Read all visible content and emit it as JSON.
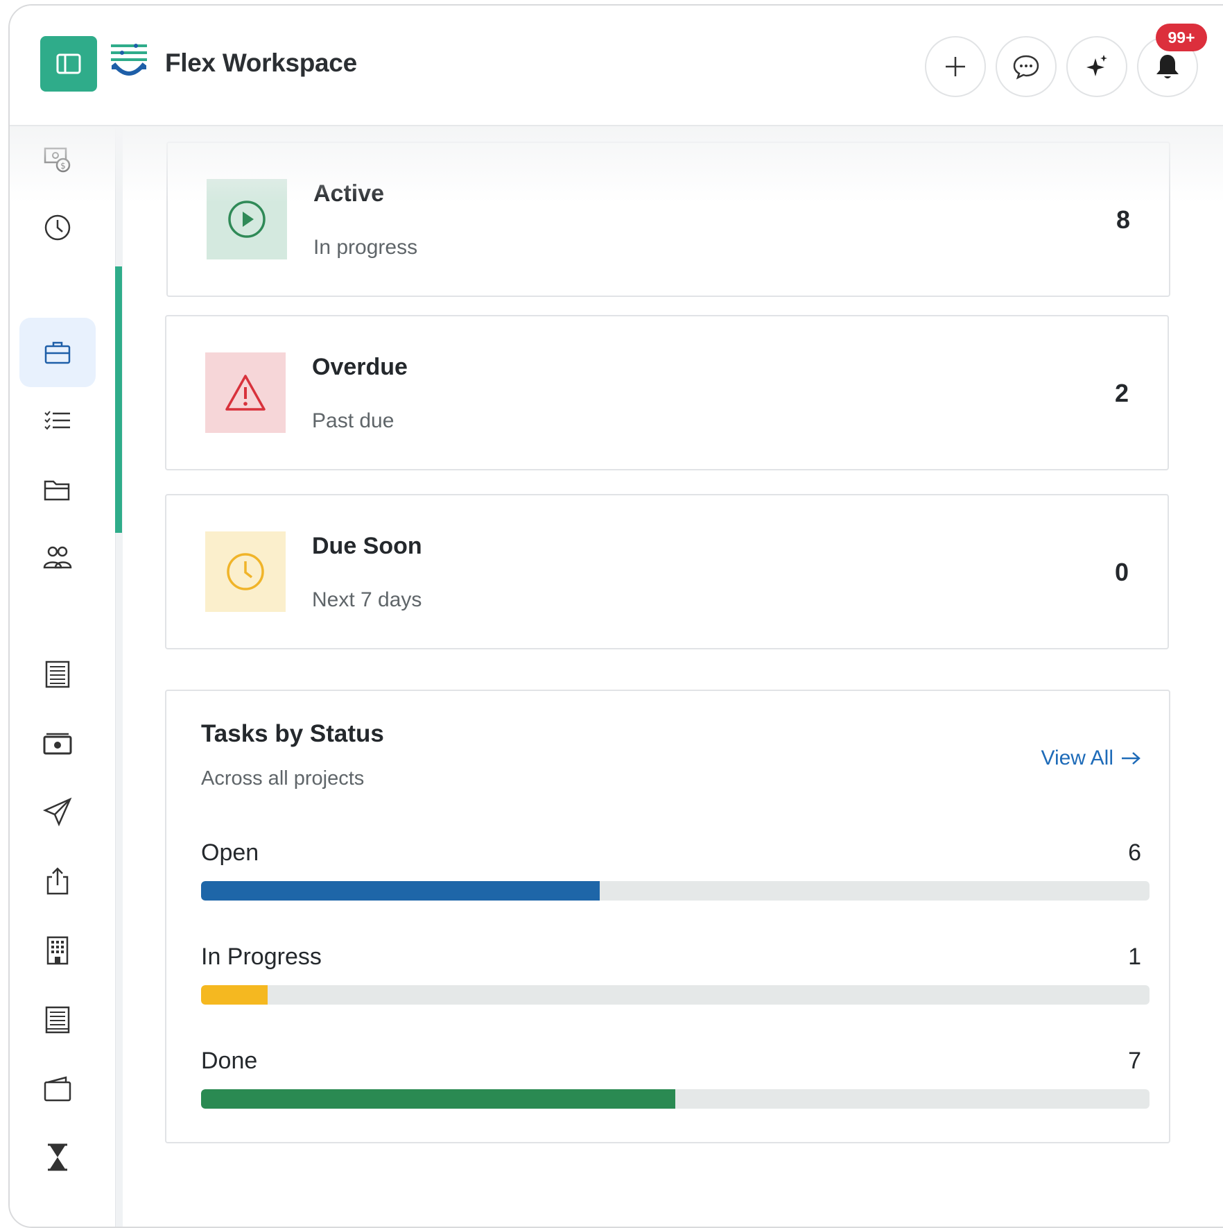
{
  "header": {
    "app_title": "Flex Workspace",
    "notification_badge": "99+",
    "actions": [
      "add-icon",
      "chat-icon",
      "sparkle-icon",
      "bell-icon"
    ]
  },
  "sidebar": {
    "items": [
      {
        "icon": "money-settings-icon",
        "active": false
      },
      {
        "icon": "clock-icon",
        "active": false
      },
      {
        "icon": "briefcase-icon",
        "active": true
      },
      {
        "icon": "checklist-icon",
        "active": false
      },
      {
        "icon": "folder-icon",
        "active": false
      },
      {
        "icon": "users-icon",
        "active": false
      },
      {
        "icon": "document-icon",
        "active": false
      },
      {
        "icon": "cash-icon",
        "active": false
      },
      {
        "icon": "send-icon",
        "active": false
      },
      {
        "icon": "share-icon",
        "active": false
      },
      {
        "icon": "building-icon",
        "active": false
      },
      {
        "icon": "ledger-icon",
        "active": false
      },
      {
        "icon": "wallet-icon",
        "active": false
      },
      {
        "icon": "hourglass-icon",
        "active": false
      }
    ]
  },
  "cards": [
    {
      "title": "Active",
      "subtitle": "In progress",
      "count": "8",
      "icon": "play-icon",
      "color": "#2f8a57",
      "bg": "#d4e9df"
    },
    {
      "title": "Overdue",
      "subtitle": "Past due",
      "count": "2",
      "icon": "warning-icon",
      "color": "#d8323c",
      "bg": "#f6d6d8"
    },
    {
      "title": "Due Soon",
      "subtitle": "Next 7 days",
      "count": "0",
      "icon": "clock-icon",
      "color": "#f0b429",
      "bg": "#fbefcc"
    }
  ],
  "tasks": {
    "title": "Tasks by Status",
    "subtitle": "Across all projects",
    "view_all": "View All",
    "rows": [
      {
        "label": "Open",
        "value": "6",
        "fill": 0.42,
        "color": "#1e66a8"
      },
      {
        "label": "In Progress",
        "value": "1",
        "fill": 0.07,
        "color": "#f5b820"
      },
      {
        "label": "Done",
        "value": "7",
        "fill": 0.5,
        "color": "#2a8a52"
      }
    ]
  }
}
